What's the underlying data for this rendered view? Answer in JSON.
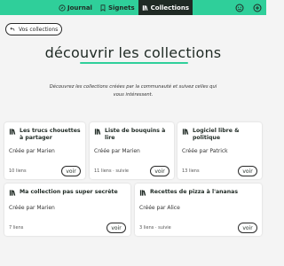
{
  "nav": {
    "tabs": [
      {
        "label": "Journal",
        "icon": "compass-icon"
      },
      {
        "label": "Signets",
        "icon": "bookmark-icon"
      },
      {
        "label": "Collections",
        "icon": "books-icon",
        "active": true
      }
    ],
    "right_icons": [
      "smiley-icon",
      "plus-icon"
    ]
  },
  "back_button": {
    "label": "Vos collections"
  },
  "page": {
    "title": "découvrir les collections",
    "intro": "Découvrez les collections créées par la communauté et suivez celles qui vous intéressent."
  },
  "collections": [
    {
      "title": "Les trucs chouettes à partager",
      "author": "Créée par Marien",
      "count": "10 liens",
      "button": "voir"
    },
    {
      "title": "Liste de bouquins à lire",
      "author": "Créée par Marien",
      "count": "11 liens · suivie",
      "button": "voir"
    },
    {
      "title": "Logiciel libre & politique",
      "author": "Créée par Patrick",
      "count": "13 liens",
      "button": "voir"
    },
    {
      "title": "Ma collection pas super secrète",
      "author": "Créée par Marien",
      "count": "7 liens",
      "button": "voir"
    },
    {
      "title": "Recettes de pizza à l'ananas",
      "author": "Créée par Alice",
      "count": "3 liens · suivie",
      "button": "voir"
    }
  ],
  "colors": {
    "accent": "#2fcf9a",
    "dark": "#1f2a24",
    "background": "#f4f4f4"
  }
}
